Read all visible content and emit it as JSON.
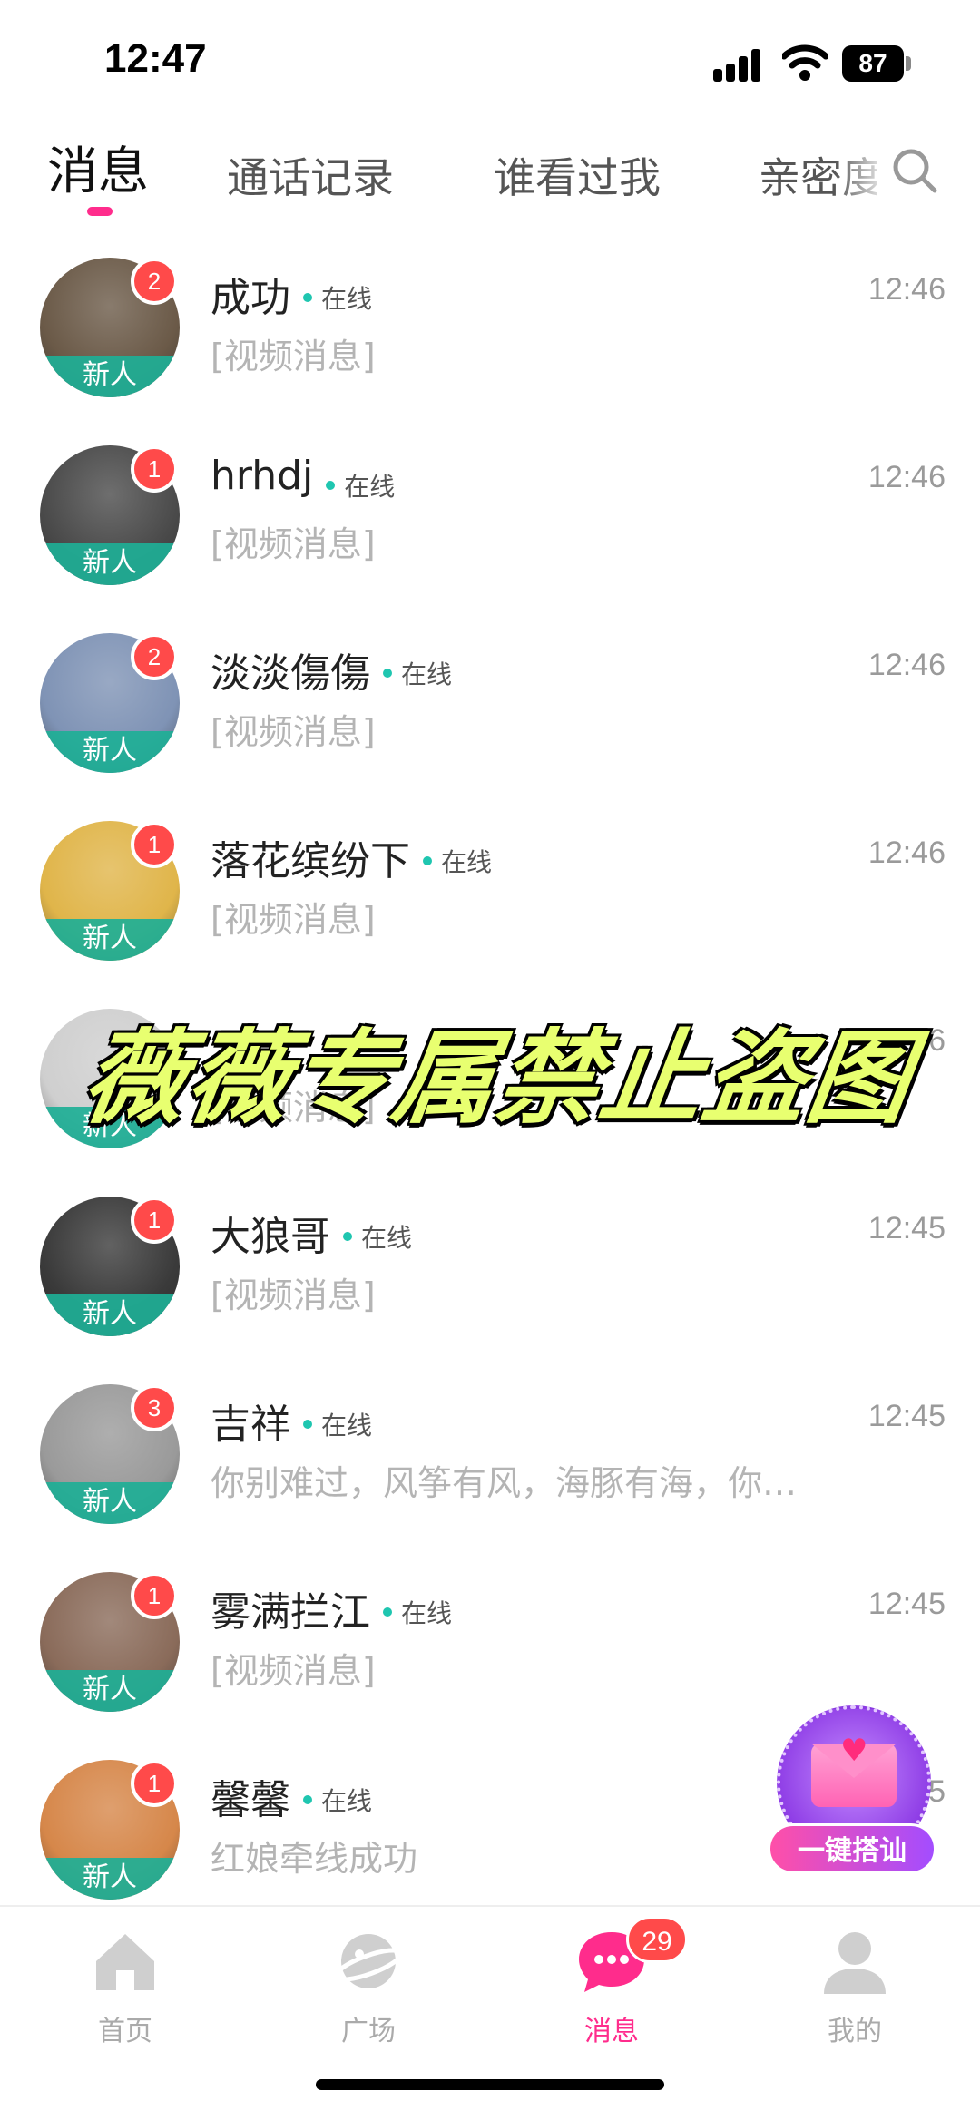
{
  "status_bar": {
    "time": "12:47",
    "battery": "87",
    "icons": [
      "signal-icon",
      "wifi-icon",
      "battery-icon"
    ]
  },
  "tabs": [
    {
      "label": "消息",
      "active": true
    },
    {
      "label": "通话记录",
      "active": false
    },
    {
      "label": "谁看过我",
      "active": false
    },
    {
      "label": "亲密度",
      "active": false
    }
  ],
  "accent_color": "#ff2c8c",
  "online_color": "#1fc6b0",
  "conversations": [
    {
      "name": "成功",
      "status": "在线",
      "time": "12:46",
      "preview": "[视频消息]",
      "unread": "2",
      "tag": "新人",
      "avatar_color": "#6b5a48"
    },
    {
      "name": "hrhdj",
      "status": "在线",
      "time": "12:46",
      "preview": "[视频消息]",
      "unread": "1",
      "tag": "新人",
      "avatar_color": "#4a4a4a"
    },
    {
      "name": "淡淡傷傷",
      "status": "在线",
      "time": "12:46",
      "preview": "[视频消息]",
      "unread": "2",
      "tag": "新人",
      "avatar_color": "#7f93b5"
    },
    {
      "name": "落花缤纷下",
      "status": "在线",
      "time": "12:46",
      "preview": "[视频消息]",
      "unread": "1",
      "tag": "新人",
      "avatar_color": "#e0b54a"
    },
    {
      "name": "",
      "status": "",
      "time": "6",
      "preview": "[视频消息]",
      "unread": "",
      "tag": "新人",
      "avatar_color": "#cfcfcf"
    },
    {
      "name": "大狼哥",
      "status": "在线",
      "time": "12:45",
      "preview": "[视频消息]",
      "unread": "1",
      "tag": "新人",
      "avatar_color": "#3a3a3a"
    },
    {
      "name": "吉祥",
      "status": "在线",
      "time": "12:45",
      "preview": "你别难过，风筝有风，海豚有海，你…",
      "unread": "3",
      "tag": "新人",
      "avatar_color": "#9a9a9a"
    },
    {
      "name": "雾满拦江",
      "status": "在线",
      "time": "12:45",
      "preview": "[视频消息]",
      "unread": "1",
      "tag": "新人",
      "avatar_color": "#8a6b5a"
    },
    {
      "name": "馨馨",
      "status": "在线",
      "time": "5",
      "preview": "红娘牵线成功",
      "unread": "1",
      "tag": "新人",
      "avatar_color": "#d6874a"
    }
  ],
  "watermark": "薇薇专属禁止盗图",
  "fab": {
    "label": "一键搭讪"
  },
  "bottom_nav": [
    {
      "label": "首页",
      "active": false
    },
    {
      "label": "广场",
      "active": false
    },
    {
      "label": "消息",
      "active": true,
      "badge": "29"
    },
    {
      "label": "我的",
      "active": false
    }
  ]
}
